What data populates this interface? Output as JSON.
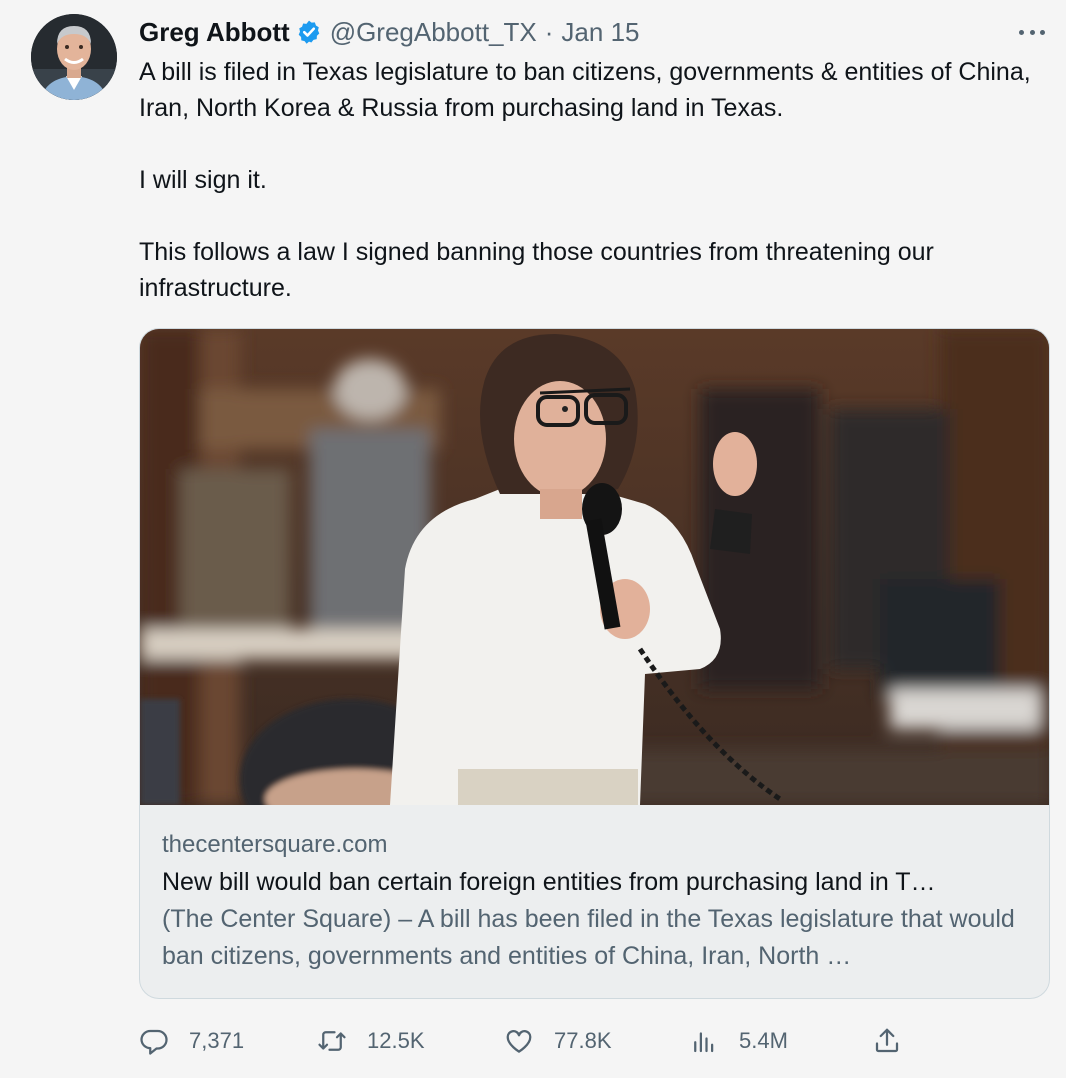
{
  "author": {
    "name": "Greg Abbott",
    "handle": "@GregAbbott_TX",
    "separator": "·",
    "date": "Jan 15",
    "verified_icon": "verified-badge-icon"
  },
  "tweet": {
    "paragraphs": [
      "A bill is filed in Texas legislature to ban citizens, governments & entities of China, Iran, North Korea & Russia from purchasing land in Texas.",
      "I will sign it.",
      "This follows a law I signed banning those countries from threatening our infrastructure."
    ]
  },
  "card": {
    "domain": "thecentersquare.com",
    "title": "New bill would ban certain foreign entities from purchasing land in T…",
    "description": "(The Center Square) – A bill has been filed in the Texas legislature that would ban citizens, governments and entities of China, Iran, North …"
  },
  "actions": {
    "replies": "7,371",
    "retweets": "12.5K",
    "likes": "77.8K",
    "views": "5.4M"
  },
  "colors": {
    "text_primary": "#0f1419",
    "text_secondary": "#536471",
    "verified_blue": "#1d9bf0",
    "card_border": "#cfd9de"
  }
}
